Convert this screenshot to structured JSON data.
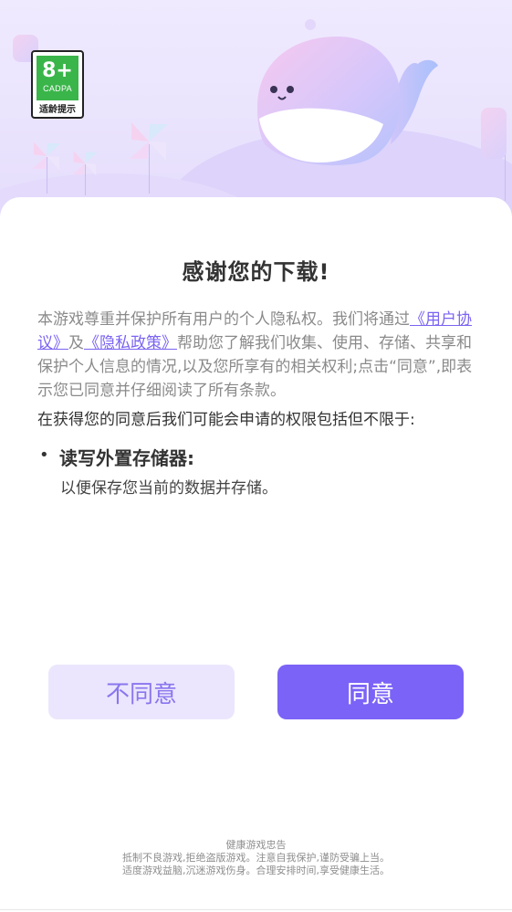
{
  "rating_badge": {
    "age": "8+",
    "org": "CADPA",
    "label": "适龄提示"
  },
  "dialog": {
    "title": "感谢您的下载!",
    "intro_prefix": "本游戏尊重并保护所有用户的个人隐私权。我们将通过",
    "user_agreement_link": "《用户协议》",
    "and_text": "及",
    "privacy_policy_link": "《隐私政策》",
    "intro_suffix": "帮助您了解我们收集、使用、存储、共享和保护个人信息的情况,以及您所享有的相关权利;点击“同意”,即表示您已同意并仔细阅读了所有条款。",
    "permissions_intro": "在获得您的同意后我们可能会申请的权限包括但不限于:",
    "permissions": [
      {
        "bullet": "•",
        "title": "读写外置存储器:",
        "description": "以便保存您当前的数据并存储。"
      }
    ]
  },
  "buttons": {
    "disagree_label": "不同意",
    "agree_label": "同意"
  },
  "footer": {
    "line1": "健康游戏忠告",
    "line2": "抵制不良游戏,拒绝盗版游戏。注意自我保护,谨防受骗上当。",
    "line3": "适度游戏益脑,沉迷游戏伤身。合理安排时间,享受健康生活。"
  },
  "colors": {
    "accent": "#7b63f7",
    "accent_light": "#ebe6fd",
    "header_bg": "#efeafe",
    "rating_green": "#3ab54a"
  },
  "icons": [
    "whale-mascot",
    "pinwheel-decoration"
  ]
}
